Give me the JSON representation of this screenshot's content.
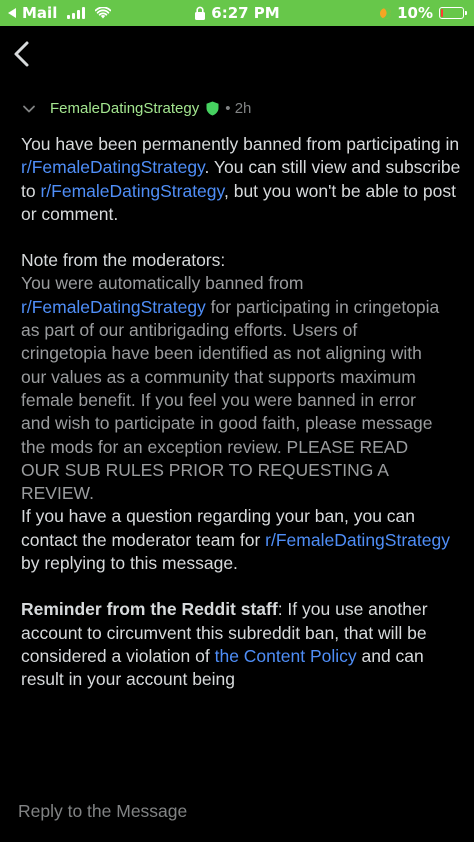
{
  "status_bar": {
    "back_app": "Mail",
    "time": "6:27 PM",
    "battery": "10%",
    "battery_level": 0.1,
    "colors": {
      "bar_bg": "#67c74a",
      "battery_fill": "#ff3b30",
      "moon": "#f5a623"
    }
  },
  "nav": {
    "back_icon": "chevron-left-icon"
  },
  "message": {
    "subreddit": "FemaleDatingStrategy",
    "time_ago": "2h",
    "separator": "•",
    "p1_a": "You have been permanently banned from participating in ",
    "p1_link": "r/FemaleDatingStrategy",
    "p1_b": ". You can still view and subscribe to ",
    "p1_link2": "r/FemaleDatingStrategy",
    "p1_c": ", but you won't be able to post or comment.",
    "note_header": "Note from the moderators:",
    "quote_a": "You were automatically banned from ",
    "quote_link": "r/FemaleDatingStrategy",
    "quote_b": " for participating in cringetopia as part of our antibrigading efforts. Users of cringetopia have been identified as not aligning with our values as a community that supports maximum female benefit. If you feel you were banned in error and wish to participate in good faith, please message the mods for an exception review. PLEASE READ OUR SUB RULES PRIOR TO REQUESTING A REVIEW.",
    "p3_a": "If you have a question regarding your ban, you can contact the moderator team for ",
    "p3_link": "r/FemaleDatingStrategy",
    "p3_b": " by replying to this message.",
    "reminder_bold": "Reminder from the Reddit staff",
    "reminder_a": ": If you use another account to circumvent this subreddit ban, that will be considered a violation of ",
    "reminder_link": "the Content Policy",
    "reminder_b": " and can result in your account being",
    "colors": {
      "text": "#d7dadc",
      "link": "#4f8ef7",
      "quote": "#9a9c9e",
      "subreddit": "#a3e58f",
      "muted": "#818384"
    }
  },
  "reply": {
    "placeholder": "Reply to the Message"
  }
}
